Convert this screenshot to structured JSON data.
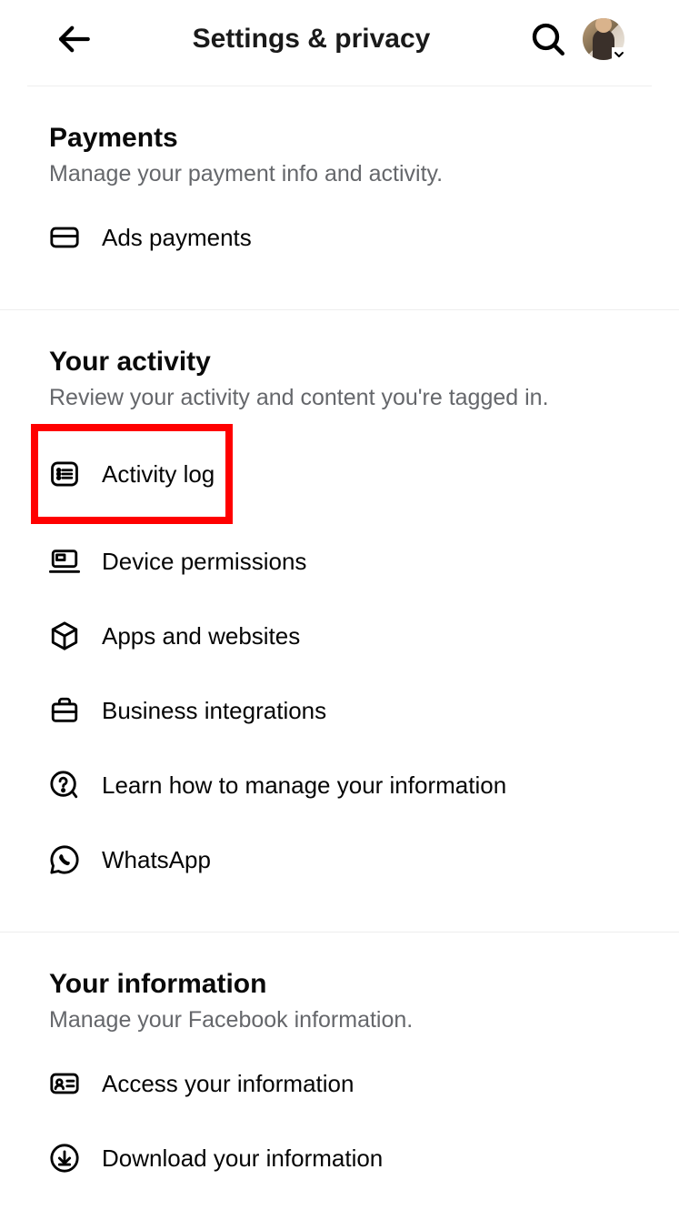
{
  "header": {
    "title": "Settings & privacy"
  },
  "sections": {
    "payments": {
      "title": "Payments",
      "desc": "Manage your payment info and activity.",
      "items": {
        "ads_payments": "Ads payments"
      }
    },
    "activity": {
      "title": "Your activity",
      "desc": "Review your activity and content you're tagged in.",
      "items": {
        "activity_log": "Activity log",
        "device_permissions": "Device permissions",
        "apps_websites": "Apps and websites",
        "business_integrations": "Business integrations",
        "manage_info": "Learn how to manage your information",
        "whatsapp": "WhatsApp"
      }
    },
    "your_info": {
      "title": "Your information",
      "desc": "Manage your Facebook information.",
      "items": {
        "access_info": "Access your information",
        "download_info": "Download your information"
      }
    }
  }
}
